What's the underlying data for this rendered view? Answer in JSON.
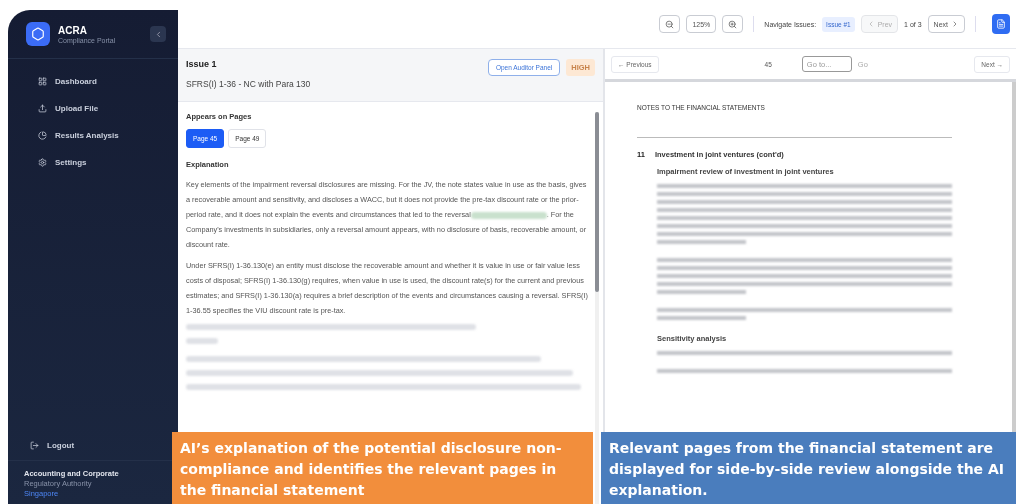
{
  "sidebar": {
    "brand": {
      "title": "ACRA",
      "subtitle": "Compliance Portal"
    },
    "items": [
      {
        "label": "Dashboard",
        "selected": false
      },
      {
        "label": "Upload File",
        "selected": false
      },
      {
        "label": "Results Analysis",
        "selected": false
      },
      {
        "label": "Settings",
        "selected": false
      }
    ],
    "logout": "Logout",
    "footer": {
      "line1": "Accounting and Corporate",
      "line2": "Regulatory Authority",
      "link": "Singapore"
    }
  },
  "toolbar": {
    "zoom": "125%",
    "navigate_label": "Navigate Issues:",
    "issue_badge": "Issue #1",
    "prev": {
      "label": "Prev",
      "disabled": true
    },
    "counter": "1 of 3",
    "next": {
      "label": "Next",
      "disabled": false
    }
  },
  "issue": {
    "title": "Issue 1",
    "subtitle": "SFRS(I) 1-36 - NC with Para 130",
    "auditor_button": "Open Auditor Panel",
    "severity": "HIGH",
    "pages_heading": "Appears on Pages",
    "pages": [
      {
        "label": "Page 45",
        "selected": true
      },
      {
        "label": "Page 49",
        "selected": false
      }
    ],
    "explanation_heading": "Explanation",
    "paragraphs": [
      {
        "kind": "text",
        "text": "Key elements of the impairment reversal disclosures are missing. For the JV, the note states value in use as the basis, gives a recoverable amount and sensitivity, and discloses a WACC, but it does not provide the pre-tax discount rate or the prior-period rate, and it does not explain the events and circumstances that led to the reversal",
        "after": ". For the Company's investments in subsidiaries, only a reversal amount appears, with no disclosure of basis, recoverable amount, or discount rate."
      },
      {
        "kind": "text",
        "text": "Under SFRS(I) 1-36.130(e) an entity must disclose the recoverable amount and whether it is value in use or fair value less costs of disposal; SFRS(I) 1-36.130(g) requires, when value in use is used, the discount rate(s) for the current and previous estimates; and SFRS(I) 1-36.130(a) requires a brief description of the events and circumstances causing a reversal. SFRS(I) 1-36.55 specifies the VIU discount rate is pre-tax."
      },
      {
        "kind": "blurred"
      },
      {
        "kind": "blurred"
      }
    ]
  },
  "viewer": {
    "previous": "← Previous",
    "page": "45",
    "goto_placeholder": "Go to...",
    "go": "Go",
    "next": "Next →",
    "document": {
      "title": "NOTES TO THE FINANCIAL STATEMENTS",
      "note_number": "11",
      "note_heading": "Investment in joint ventures (cont'd)",
      "sections": [
        {
          "heading": "Impairment review of investment in joint ventures"
        },
        {
          "heading": "Sensitivity analysis"
        }
      ]
    }
  },
  "callouts": [
    {
      "text": "AI’s explanation of the potential disclosure non-compliance and identifies the relevant pages in the financial statement",
      "color": "#f28e3c"
    },
    {
      "text": "Relevant pages from the financial statement are displayed for side-by-side review alongside the AI explanation.",
      "color": "#4a7dbd"
    }
  ]
}
